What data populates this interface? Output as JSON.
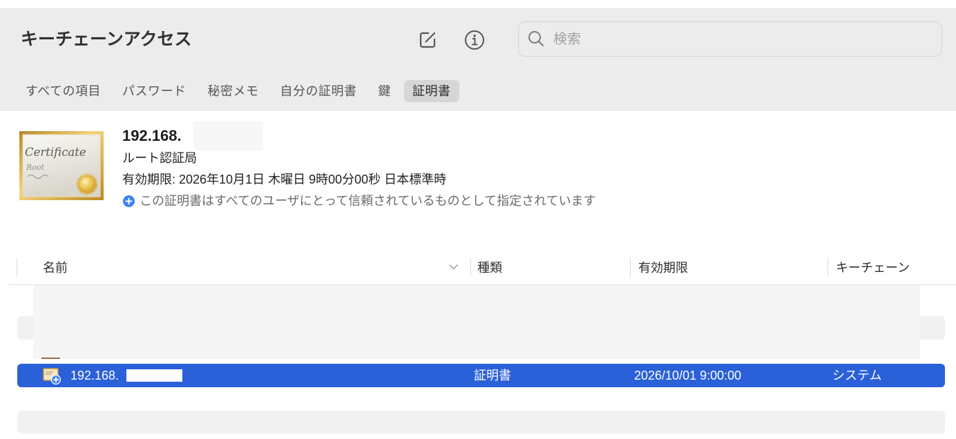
{
  "window": {
    "title": "キーチェーンアクセス"
  },
  "toolbar": {
    "compose_icon": "compose-icon",
    "info_icon": "info-icon",
    "search": {
      "icon": "search-icon",
      "placeholder": "検索",
      "value": ""
    }
  },
  "tabs": [
    {
      "label": "すべての項目",
      "selected": false
    },
    {
      "label": "パスワード",
      "selected": false
    },
    {
      "label": "秘密メモ",
      "selected": false
    },
    {
      "label": "自分の証明書",
      "selected": false
    },
    {
      "label": "鍵",
      "selected": false
    },
    {
      "label": "証明書",
      "selected": true
    }
  ],
  "details": {
    "image": {
      "title": "Certificate",
      "subtitle": "Root"
    },
    "name": "192.168.",
    "kind": "ルート認証局",
    "expiry": "有効期限: 2026年10月1日 木曜日 9時00分00秒 日本標準時",
    "trust": {
      "icon": "plus-circle-icon",
      "text": "この証明書はすべてのユーザにとって信頼されているものとして指定されています"
    }
  },
  "table": {
    "columns": [
      {
        "label": "名前",
        "sort_icon": "chevron-down-icon"
      },
      {
        "label": "種類"
      },
      {
        "label": "有効期限"
      },
      {
        "label": "キーチェーン"
      }
    ],
    "rows": [
      {
        "icon": "certificate-icon",
        "name": "192.168.",
        "kind": "証明書",
        "expires": "2026/10/01 9:00:00",
        "keychain": "システム",
        "selected": true
      }
    ]
  },
  "colors": {
    "toolbar_bg": "#ececec",
    "selection": "#2a60d8",
    "trust_icon": "#3b82f6",
    "stripe": "#f1f1f1"
  }
}
